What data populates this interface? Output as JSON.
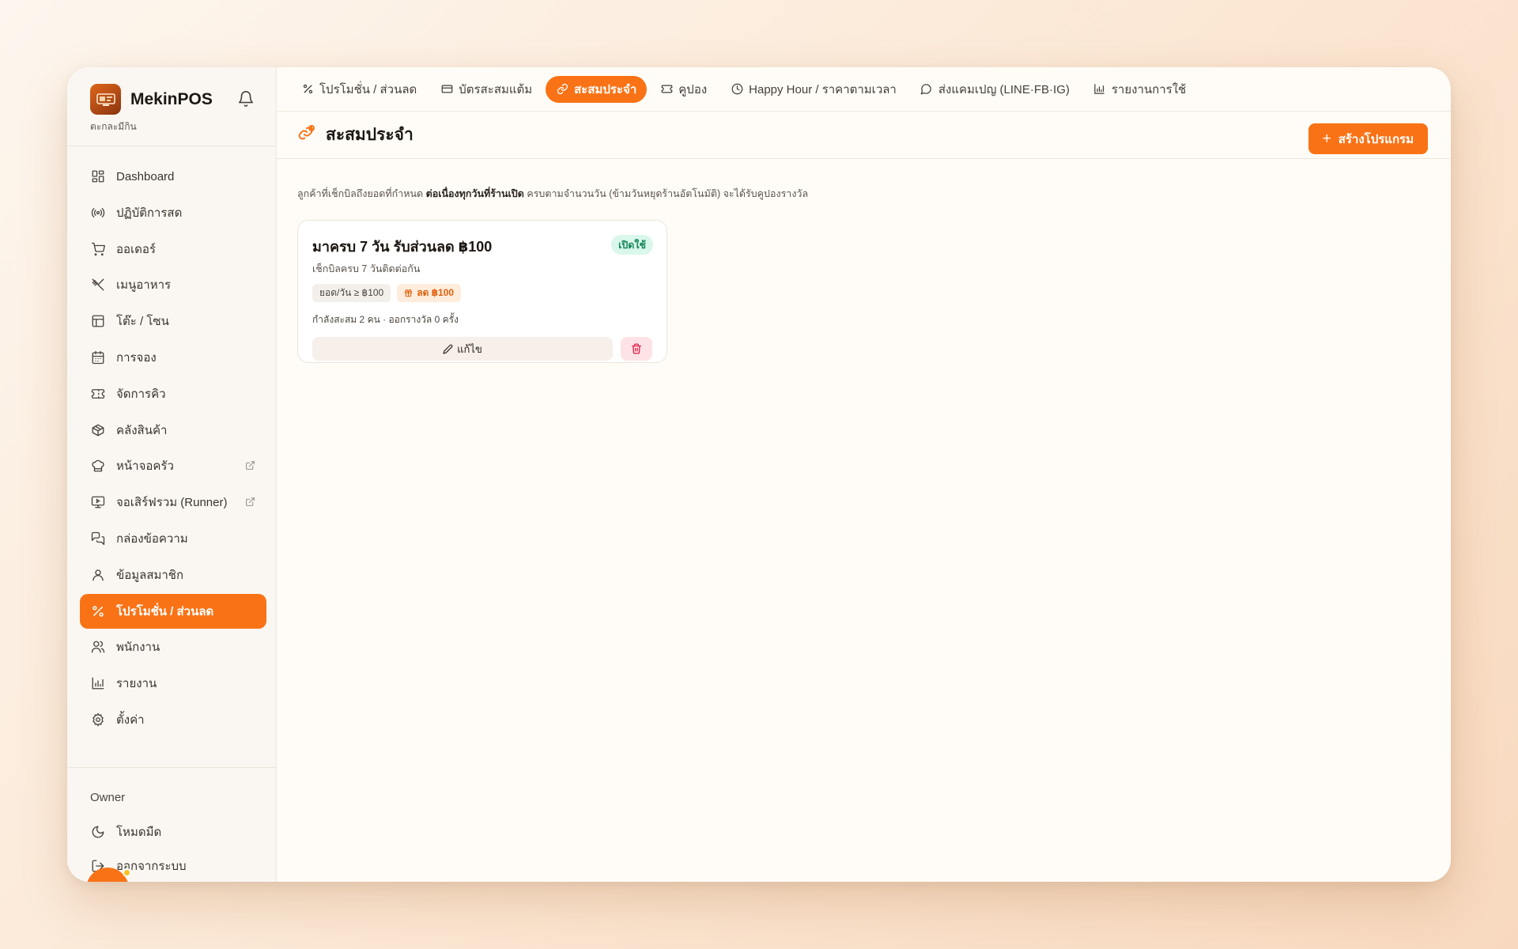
{
  "brand": {
    "name": "MekinPOS",
    "subtitle": "ตะกละมีกิน"
  },
  "sidebar": {
    "items": [
      {
        "label": "Dashboard"
      },
      {
        "label": "ปฏิบัติการสด"
      },
      {
        "label": "ออเดอร์"
      },
      {
        "label": "เมนูอาหาร"
      },
      {
        "label": "โต๊ะ / โซน"
      },
      {
        "label": "การจอง"
      },
      {
        "label": "จัดการคิว"
      },
      {
        "label": "คลังสินค้า"
      },
      {
        "label": "หน้าจอครัว"
      },
      {
        "label": "จอเสิร์ฟรวม (Runner)"
      },
      {
        "label": "กล่องข้อความ"
      },
      {
        "label": "ข้อมูลสมาชิก"
      },
      {
        "label": "โปรโมชั่น / ส่วนลด"
      },
      {
        "label": "พนักงาน"
      },
      {
        "label": "รายงาน"
      },
      {
        "label": "ตั้งค่า"
      }
    ],
    "active_index": 12,
    "role": "Owner",
    "dark_mode": "โหมดมืด",
    "logout": "ออกจากระบบ"
  },
  "tabs": [
    {
      "label": "โปรโมชั่น / ส่วนลด"
    },
    {
      "label": "บัตรสะสมแต้ม"
    },
    {
      "label": "สะสมประจำ"
    },
    {
      "label": "คูปอง"
    },
    {
      "label": "Happy Hour / ราคาตามเวลา"
    },
    {
      "label": "ส่งแคมเปญ (LINE·FB·IG)"
    },
    {
      "label": "รายงานการใช้"
    }
  ],
  "page": {
    "title": "สะสมประจำ",
    "create_button": "สร้างโปรแกรม",
    "description_pre": "ลูกค้าที่เช็กบิลถึงยอดที่กำหนด ",
    "description_bold": "ต่อเนื่องทุกวันที่ร้านเปิด",
    "description_post": " ครบตามจำนวนวัน (ข้ามวันหยุดร้านอัตโนมัติ) จะได้รับคูปองรางวัล"
  },
  "program_card": {
    "title": "มาครบ 7 วัน รับส่วนลด ฿100",
    "status": "เปิดใช้",
    "subtitle": "เช็กบิลครบ 7 วันติดต่อกัน",
    "chip_threshold": "ยอด/วัน ≥ ฿100",
    "chip_reward": "ลด ฿100",
    "stats": "กำลังสะสม 2 คน · ออกรางวัล 0 ครั้ง",
    "edit_label": "แก้ไข"
  },
  "colors": {
    "accent": "#f97316",
    "status_green": "#14865b",
    "danger": "#e11d48"
  }
}
